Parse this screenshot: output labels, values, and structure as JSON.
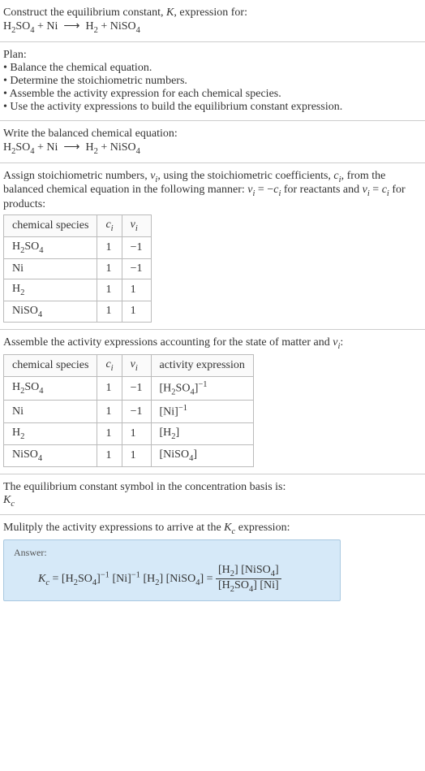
{
  "intro": {
    "line1": "Construct the equilibrium constant, ",
    "k": "K",
    "line1b": ", expression for:",
    "eq_h2so4": "H",
    "eq_2": "2",
    "eq_so4": "SO",
    "eq_4": "4",
    "eq_plus": " + ",
    "eq_ni": "Ni",
    "eq_arrow": "⟶",
    "eq_h2": "H",
    "eq_niso4": "NiSO"
  },
  "plan": {
    "title": "Plan:",
    "b1": "• Balance the chemical equation.",
    "b2": "• Determine the stoichiometric numbers.",
    "b3": "• Assemble the activity expression for each chemical species.",
    "b4": "• Use the activity expressions to build the equilibrium constant expression."
  },
  "balanced": {
    "title": "Write the balanced chemical equation:"
  },
  "stoich": {
    "desc1": "Assign stoichiometric numbers, ",
    "nu": "ν",
    "i": "i",
    "desc2": ", using the stoichiometric coefficients, ",
    "c": "c",
    "desc3": ", from the balanced chemical equation in the following manner: ",
    "eq1": " = −",
    "desc4": " for reactants and ",
    "eq2": " = ",
    "desc5": " for products:",
    "headers": [
      "chemical species",
      "cᵢ",
      "νᵢ"
    ],
    "rows": [
      {
        "species": "H₂SO₄",
        "c": "1",
        "nu": "−1"
      },
      {
        "species": "Ni",
        "c": "1",
        "nu": "−1"
      },
      {
        "species": "H₂",
        "c": "1",
        "nu": "1"
      },
      {
        "species": "NiSO₄",
        "c": "1",
        "nu": "1"
      }
    ]
  },
  "activity": {
    "title": "Assemble the activity expressions accounting for the state of matter and ",
    "colon": ":",
    "headers": [
      "chemical species",
      "cᵢ",
      "νᵢ",
      "activity expression"
    ],
    "rows": [
      {
        "species": "H₂SO₄",
        "c": "1",
        "nu": "−1",
        "expr": "[H₂SO₄]⁻¹"
      },
      {
        "species": "Ni",
        "c": "1",
        "nu": "−1",
        "expr": "[Ni]⁻¹"
      },
      {
        "species": "H₂",
        "c": "1",
        "nu": "1",
        "expr": "[H₂]"
      },
      {
        "species": "NiSO₄",
        "c": "1",
        "nu": "1",
        "expr": "[NiSO₄]"
      }
    ]
  },
  "symbol": {
    "line": "The equilibrium constant symbol in the concentration basis is:",
    "kc_k": "K",
    "kc_c": "c"
  },
  "multiply": {
    "line1": "Mulitply the activity expressions to arrive at the ",
    "line2": " expression:"
  },
  "answer": {
    "label": "Answer:",
    "eq_part1": " = [H",
    "eq_part2": "SO",
    "eq_part3": "]",
    "neg1": "−1",
    "ni_part": " [Ni]",
    "h2_part": " [H",
    "close": "]",
    "niso4_part": " [NiSO",
    "equals": " = ",
    "num": "[H₂] [NiSO₄]",
    "den": "[H₂SO₄] [Ni]"
  }
}
